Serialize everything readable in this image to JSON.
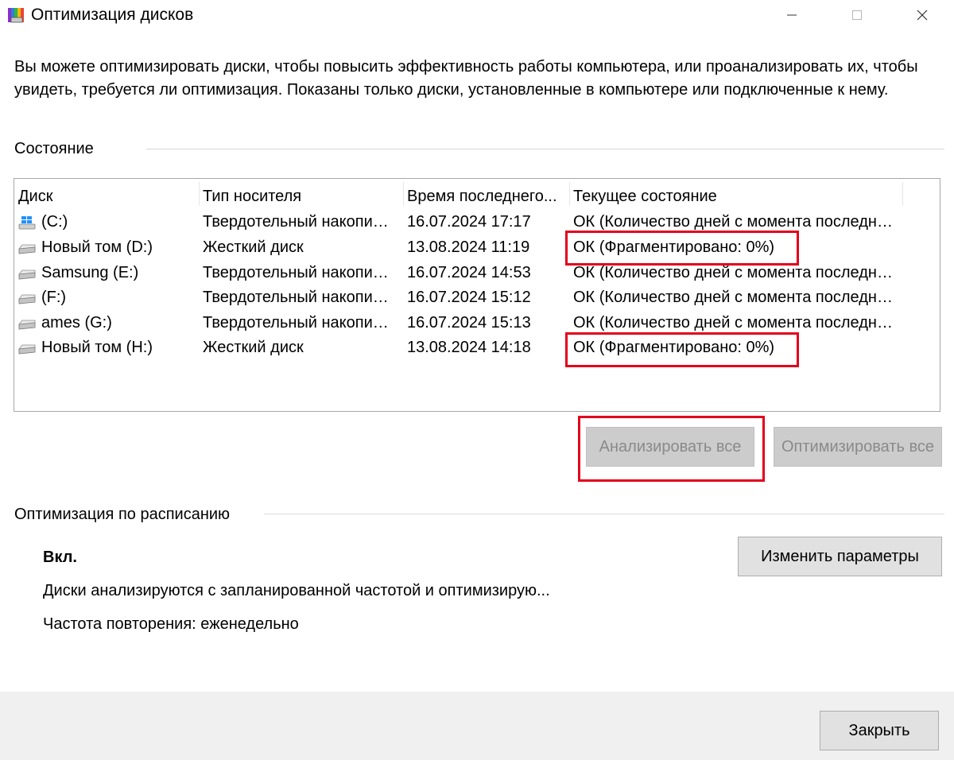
{
  "window": {
    "title": "Оптимизация дисков",
    "icon": "defrag-app-icon"
  },
  "intro": "Вы можете оптимизировать диски, чтобы повысить эффективность работы  компьютера, или проанализировать их, чтобы увидеть, требуется ли оптимизация. Показаны только диски, установленные в компьютере или подключенные к нему.",
  "status_section": {
    "label": "Состояние",
    "columns": [
      "Диск",
      "Тип носителя",
      "Время последнего...",
      "Текущее состояние"
    ],
    "rows": [
      {
        "disk": "(C:)",
        "icon": "windows-drive-icon",
        "type": "Твердотельный накопитель",
        "time": "16.07.2024 17:17",
        "status": "ОК (Количество дней с момента последней оптимизации)"
      },
      {
        "disk": "Новый том (D:)",
        "icon": "drive-icon",
        "type": "Жесткий диск",
        "time": "13.08.2024 11:19",
        "status": "ОК (Фрагментировано: 0%)"
      },
      {
        "disk": "Samsung (E:)",
        "icon": "drive-icon",
        "type": "Твердотельный накопитель",
        "time": "16.07.2024 14:53",
        "status": "ОК (Количество дней с момента последней оптимизации)"
      },
      {
        "disk": "(F:)",
        "icon": "drive-icon",
        "type": "Твердотельный накопитель",
        "time": "16.07.2024 15:12",
        "status": "ОК (Количество дней с момента последней оптимизации)"
      },
      {
        "disk": "ames (G:)",
        "icon": "drive-icon",
        "type": "Твердотельный накопитель",
        "time": "16.07.2024 15:13",
        "status": "ОК (Количество дней с момента последней оптимизации)"
      },
      {
        "disk": "Новый том (H:)",
        "icon": "drive-icon",
        "type": "Жесткий диск",
        "time": "13.08.2024 14:18",
        "status": "ОК (Фрагментировано: 0%)"
      }
    ]
  },
  "buttons": {
    "analyze_all": "Анализировать все",
    "optimize_all": "Оптимизировать все",
    "change_settings": "Изменить параметры",
    "close": "Закрыть"
  },
  "schedule": {
    "label": "Оптимизация по расписанию",
    "state": "Вкл.",
    "description": "Диски анализируются с запланированной частотой и оптимизирую...",
    "frequency": "Частота повторения: еженедельно"
  },
  "colors": {
    "highlight": "#e3001b",
    "button_bg": "#e1e1e1",
    "footer_bg": "#f0f0f0"
  }
}
